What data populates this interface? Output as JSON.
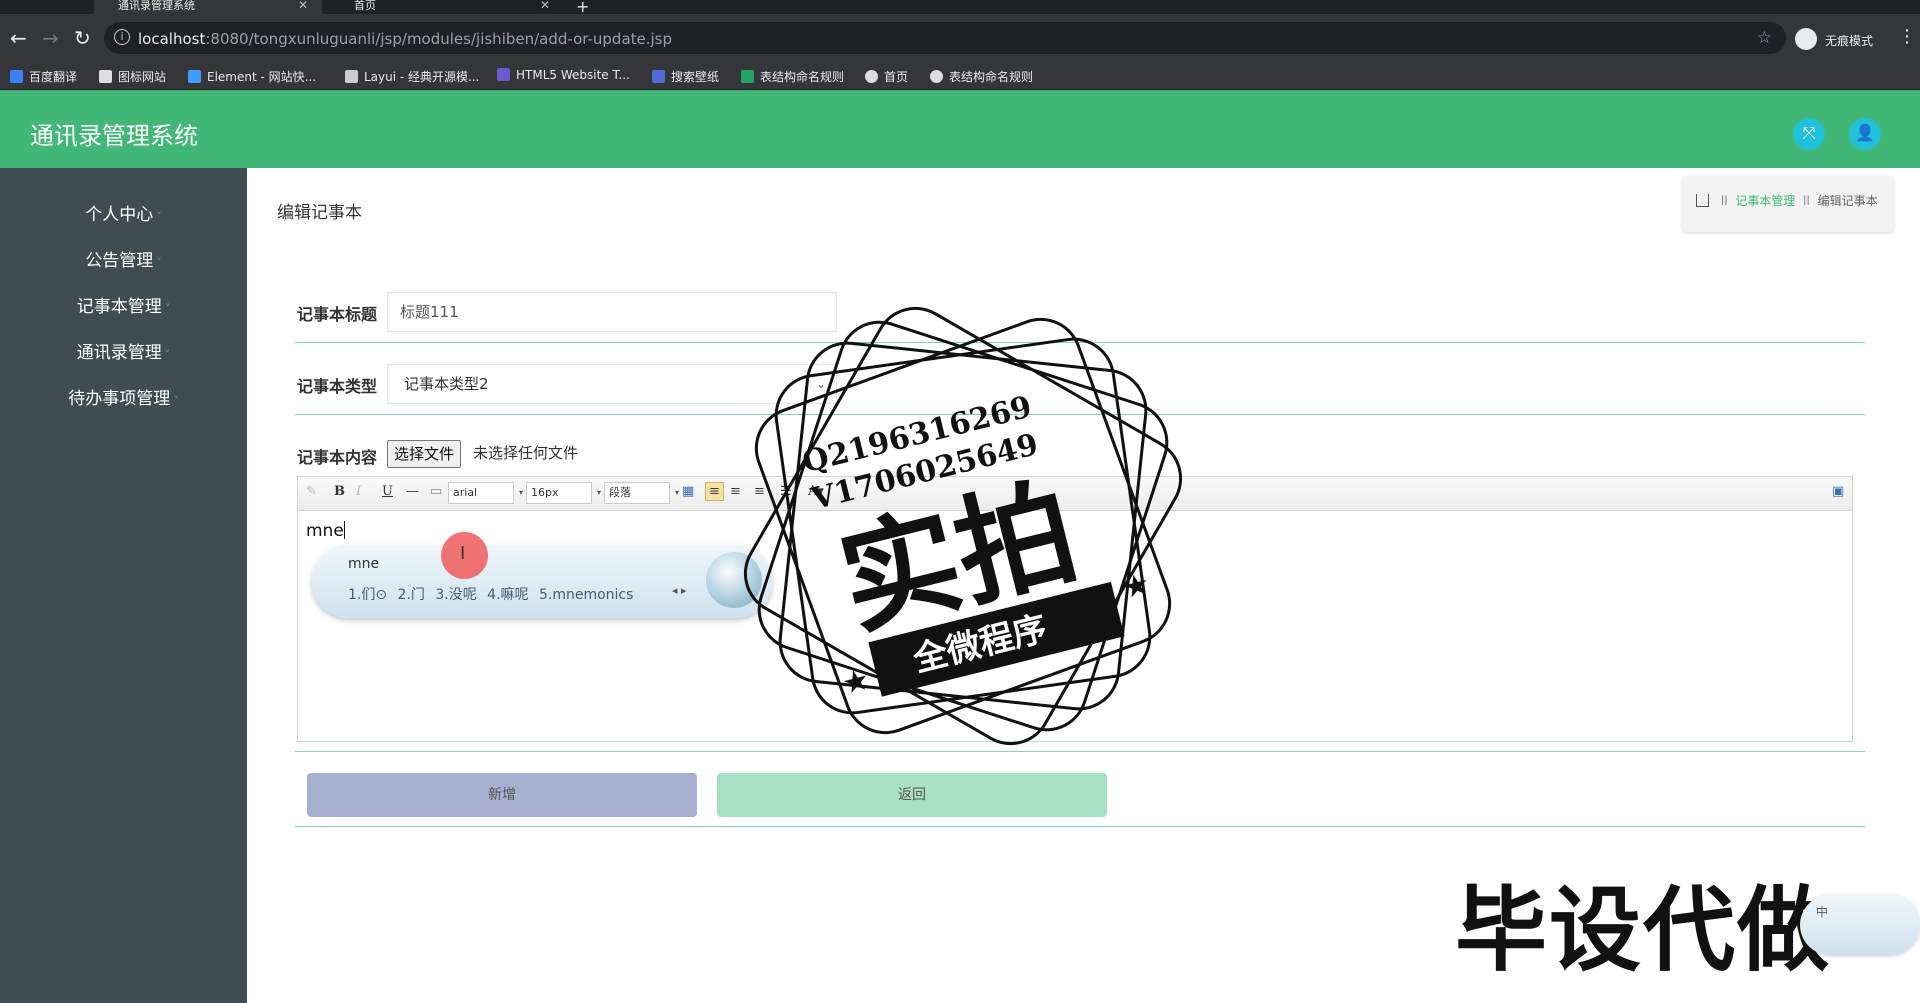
{
  "browser": {
    "tabs": [
      {
        "title": "通讯录管理系统",
        "active": true
      },
      {
        "title": "首页",
        "active": false
      }
    ],
    "new_tab_symbol": "+",
    "url_host": "localhost",
    "url_rest": ":8080/tongxunluguanli/jsp/modules/jishiben/add-or-update.jsp",
    "incognito_label": "无痕模式",
    "bookmarks": [
      "百度翻译",
      "图标网站",
      "Element - 网站快...",
      "Layui - 经典开源模...",
      "HTML5 Website T...",
      "搜索壁纸",
      "表结构命名规则",
      "首页",
      "表结构命名规则"
    ]
  },
  "app": {
    "title": "通讯录管理系统"
  },
  "sidebar": {
    "items": [
      "个人中心",
      "公告管理",
      "记事本管理",
      "通讯录管理",
      "待办事项管理"
    ]
  },
  "page": {
    "title": "编辑记事本",
    "breadcrumb": {
      "sep": "ll",
      "link": "记事本管理",
      "current": "编辑记事本"
    }
  },
  "form": {
    "title_label": "记事本标题",
    "title_value": "标题111",
    "type_label": "记事本类型",
    "type_value": "记事本类型2",
    "content_label": "记事本内容",
    "file_button": "选择文件",
    "file_status": "未选择任何文件",
    "editor_font": "arial",
    "editor_size": "16px",
    "editor_paragraph": "段落",
    "editor_text": "mne",
    "add_button": "新增",
    "back_button": "返回"
  },
  "ime": {
    "composition": "mne",
    "candidates": [
      "1.们⊙",
      "2.门",
      "3.没呢",
      "4.嘛呢",
      "5.mnemonics"
    ]
  },
  "watermark": {
    "contact_q": "Q2196316269",
    "contact_v": "V1706025649",
    "big": "实拍",
    "banner": "全微程序",
    "bottom": "毕设代做",
    "ime_mini": "中"
  },
  "colors": {
    "header": "#41b878",
    "sidebar": "#3f4d53",
    "accent": "#1fc0d8",
    "add_button": "#a6afd0",
    "back_button": "#a8e0c4"
  }
}
